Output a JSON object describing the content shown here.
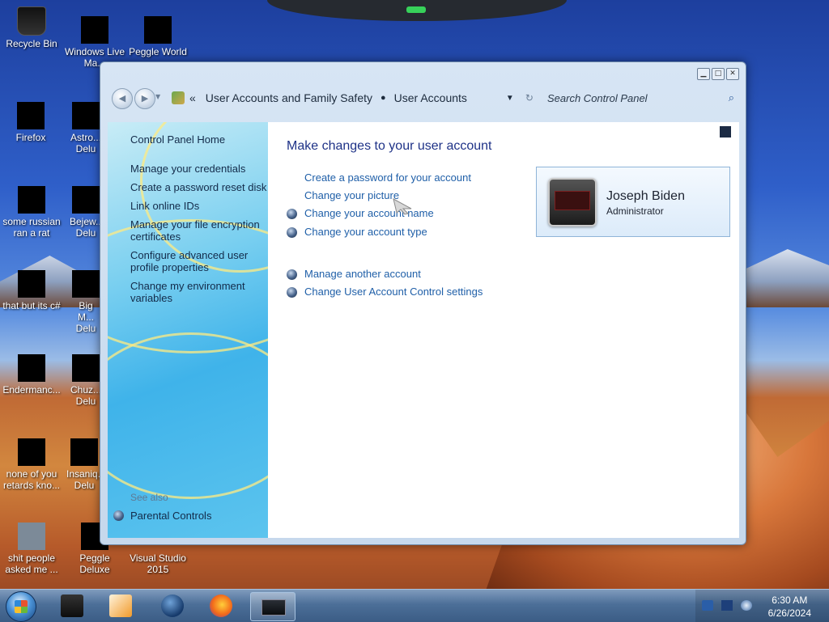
{
  "desktop": {
    "icons": [
      {
        "label": "Recycle Bin"
      },
      {
        "label": "Windows Live Ma..."
      },
      {
        "label": "Peggle World"
      },
      {
        "label": "Firefox"
      },
      {
        "label": "Astro... Delu"
      },
      {
        "label": "some russian ran a rat"
      },
      {
        "label": "Bejew... Delu"
      },
      {
        "label": "that but its c#"
      },
      {
        "label": "Big M... Delu"
      },
      {
        "label": "Endermanc..."
      },
      {
        "label": "Chuz... Delu"
      },
      {
        "label": "none of you retards kno..."
      },
      {
        "label": "Insaniq... Delu"
      },
      {
        "label": "shit people asked me ..."
      },
      {
        "label": "Peggle Deluxe"
      },
      {
        "label": "Visual Studio 2015"
      }
    ]
  },
  "window": {
    "caption_buttons": [
      "minimize",
      "maximize",
      "close"
    ],
    "breadcrumb": {
      "overflow": "«",
      "items": [
        "User Accounts and Family Safety",
        "User Accounts"
      ],
      "separator": "▸"
    },
    "search_placeholder": "Search Control Panel",
    "sidebar": {
      "home": "Control Panel Home",
      "links": [
        "Manage your credentials",
        "Create a password reset disk",
        "Link online IDs",
        "Manage your file encryption certificates",
        "Configure advanced user profile properties",
        "Change my environment variables"
      ],
      "see_also_title": "See also",
      "see_also_links": [
        "Parental Controls"
      ]
    },
    "main": {
      "heading": "Make changes to your user account",
      "tasks": [
        {
          "label": "Create a password for your account",
          "shield": false
        },
        {
          "label": "Change your picture",
          "shield": false
        },
        {
          "label": "Change your account name",
          "shield": true
        },
        {
          "label": "Change your account type",
          "shield": true
        }
      ],
      "tasks2": [
        {
          "label": "Manage another account",
          "shield": true
        },
        {
          "label": "Change User Account Control settings",
          "shield": true
        }
      ],
      "user": {
        "name": "Joseph Biden",
        "role": "Administrator"
      }
    }
  },
  "taskbar": {
    "items": [
      "explorer",
      "media-player",
      "globe",
      "firefox",
      "control-panel"
    ],
    "active_item": "control-panel",
    "clock": {
      "time": "6:30 AM",
      "date": "6/26/2024"
    }
  },
  "colors": {
    "link": "#1f5fa8",
    "heading": "#1e3287",
    "sidebar_text": "#132b4a"
  }
}
